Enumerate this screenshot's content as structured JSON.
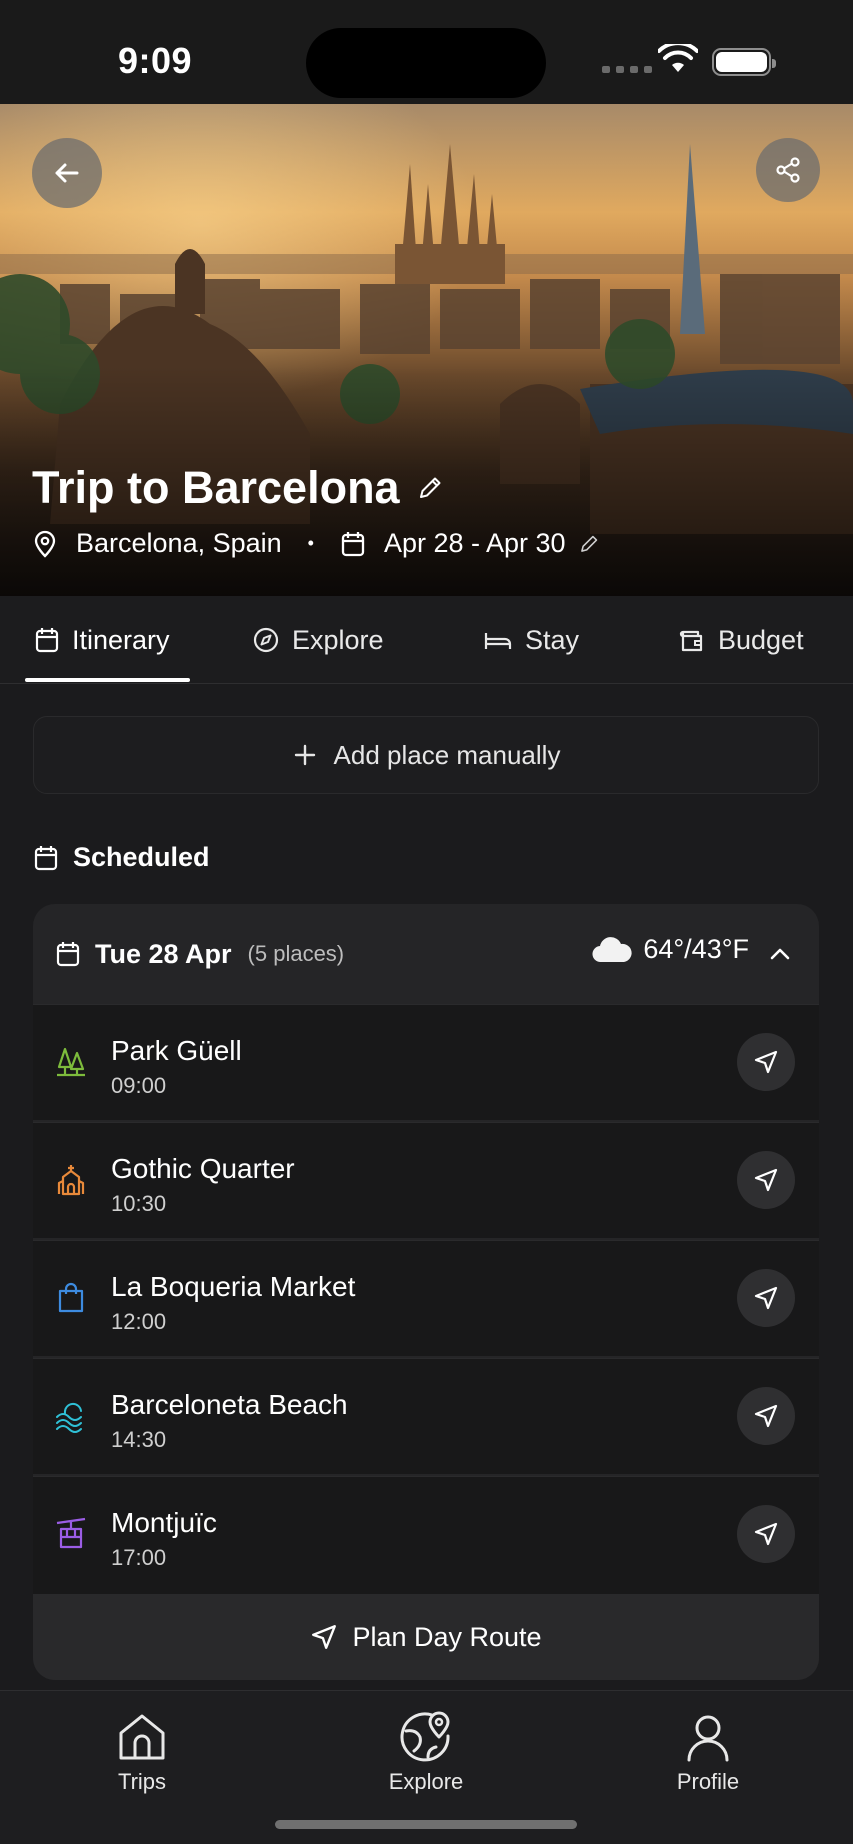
{
  "status_bar": {
    "time": "9:09"
  },
  "hero": {
    "title": "Trip to Barcelona",
    "location": "Barcelona, Spain",
    "separator": "•",
    "dates": "Apr 28 - Apr 30"
  },
  "tabs": [
    {
      "label": "Itinerary",
      "icon": "calendar-icon",
      "active": true
    },
    {
      "label": "Explore",
      "icon": "compass-icon",
      "active": false
    },
    {
      "label": "Stay",
      "icon": "bed-icon",
      "active": false
    },
    {
      "label": "Budget",
      "icon": "wallet-icon",
      "active": false
    }
  ],
  "add_place": {
    "label": "Add place manually"
  },
  "scheduled": {
    "label": "Scheduled"
  },
  "day": {
    "date": "Tue 28 Apr",
    "count": "(5 places)",
    "weather": "64°/43°F",
    "places": [
      {
        "name": "Park Güell",
        "time": "09:00",
        "icon": "trees-icon",
        "color": "#7dbb3c"
      },
      {
        "name": "Gothic Quarter",
        "time": "10:30",
        "icon": "church-icon",
        "color": "#e8893a"
      },
      {
        "name": "La Boqueria Market",
        "time": "12:00",
        "icon": "shopping-bag-icon",
        "color": "#3d8be0"
      },
      {
        "name": "Barceloneta Beach",
        "time": "14:30",
        "icon": "waves-icon",
        "color": "#2fc0d6"
      },
      {
        "name": "Montjuïc",
        "time": "17:00",
        "icon": "cable-car-icon",
        "color": "#9b5de5"
      }
    ],
    "plan_route": "Plan Day Route"
  },
  "bottom_nav": [
    {
      "label": "Trips",
      "icon": "home-icon"
    },
    {
      "label": "Explore",
      "icon": "map-pin-globe-icon"
    },
    {
      "label": "Profile",
      "icon": "user-icon"
    }
  ]
}
